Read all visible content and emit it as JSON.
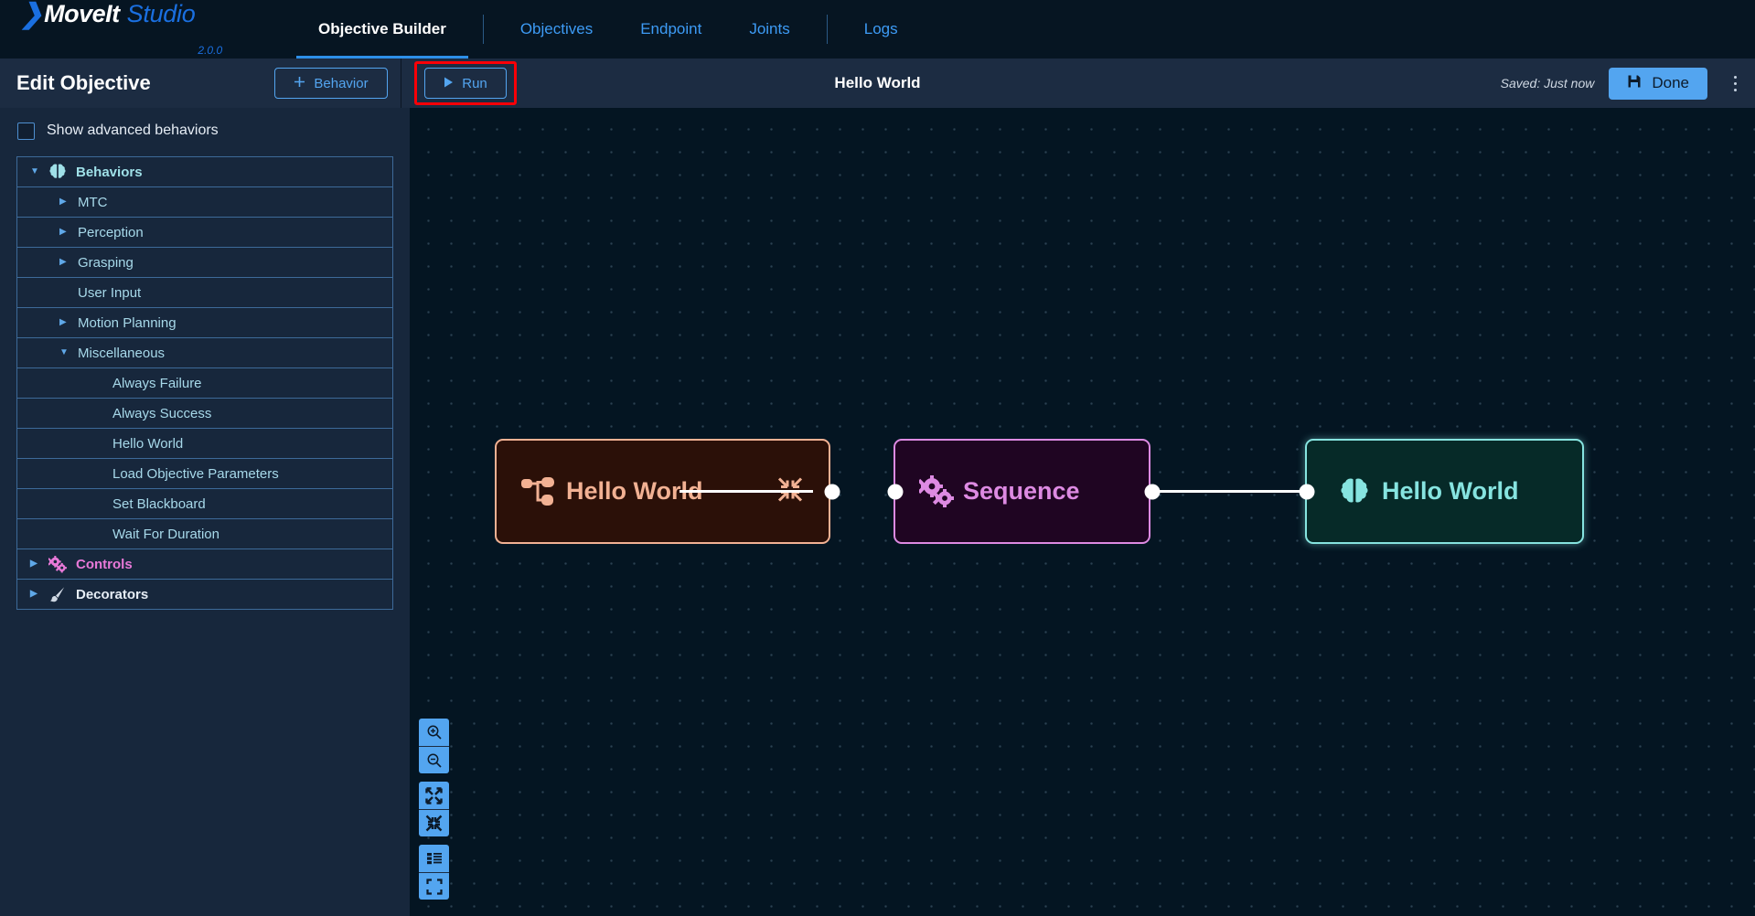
{
  "brand": {
    "chevron_icon": "chevron-right-icon",
    "name_primary": "MoveIt",
    "name_secondary": "Studio",
    "version": "2.0.0"
  },
  "nav": {
    "tabs": [
      {
        "label": "Objective Builder",
        "active": true
      },
      {
        "label": "Objectives",
        "active": false
      },
      {
        "label": "Endpoint",
        "active": false
      },
      {
        "label": "Joints",
        "active": false
      },
      {
        "label": "Logs",
        "active": false
      }
    ]
  },
  "subheader": {
    "title": "Edit Objective",
    "behavior_button": {
      "label": "Behavior",
      "icon": "plus-icon"
    },
    "run_button": {
      "label": "Run",
      "icon": "play-icon",
      "highlighted": true,
      "highlight_color": "#fb0007"
    },
    "document_title": "Hello World",
    "saved_status": "Saved: Just now",
    "done_button": {
      "label": "Done",
      "icon": "save-floppy-icon"
    },
    "overflow_menu_icon": "kebab-menu-icon"
  },
  "sidebar": {
    "advanced_toggle": {
      "label": "Show advanced behaviors",
      "checked": false
    },
    "tree": [
      {
        "label": "Behaviors",
        "depth": 0,
        "caret": "down",
        "icon": "brain-icon",
        "icon_class": "c-brain",
        "label_class": "lbl-behaviors",
        "bold": true
      },
      {
        "label": "MTC",
        "depth": 1,
        "caret": "right",
        "icon": "",
        "icon_class": "",
        "label_class": "",
        "bold": false
      },
      {
        "label": "Perception",
        "depth": 1,
        "caret": "right",
        "icon": "",
        "icon_class": "",
        "label_class": "",
        "bold": false
      },
      {
        "label": "Grasping",
        "depth": 1,
        "caret": "right",
        "icon": "",
        "icon_class": "",
        "label_class": "",
        "bold": false
      },
      {
        "label": "User Input",
        "depth": 1,
        "caret": "none",
        "icon": "",
        "icon_class": "",
        "label_class": "",
        "bold": false
      },
      {
        "label": "Motion Planning",
        "depth": 1,
        "caret": "right",
        "icon": "",
        "icon_class": "",
        "label_class": "",
        "bold": false
      },
      {
        "label": "Miscellaneous",
        "depth": 1,
        "caret": "down",
        "icon": "",
        "icon_class": "",
        "label_class": "",
        "bold": false
      },
      {
        "label": "Always Failure",
        "depth": 2,
        "caret": "none",
        "icon": "",
        "icon_class": "",
        "label_class": "",
        "bold": false
      },
      {
        "label": "Always Success",
        "depth": 2,
        "caret": "none",
        "icon": "",
        "icon_class": "",
        "label_class": "",
        "bold": false
      },
      {
        "label": "Hello World",
        "depth": 2,
        "caret": "none",
        "icon": "",
        "icon_class": "",
        "label_class": "",
        "bold": false
      },
      {
        "label": "Load Objective Parameters",
        "depth": 2,
        "caret": "none",
        "icon": "",
        "icon_class": "",
        "label_class": "",
        "bold": false
      },
      {
        "label": "Set Blackboard",
        "depth": 2,
        "caret": "none",
        "icon": "",
        "icon_class": "",
        "label_class": "",
        "bold": false
      },
      {
        "label": "Wait For Duration",
        "depth": 2,
        "caret": "none",
        "icon": "",
        "icon_class": "",
        "label_class": "",
        "bold": false
      },
      {
        "label": "Controls",
        "depth": 0,
        "caret": "right",
        "icon": "gears-icon",
        "icon_class": "c-pink",
        "label_class": "lbl-controls",
        "bold": true
      },
      {
        "label": "Decorators",
        "depth": 0,
        "caret": "right",
        "icon": "paintbrush-icon",
        "icon_class": "c-gray",
        "label_class": "lbl-decorators",
        "bold": true
      }
    ]
  },
  "canvas": {
    "nodes": [
      {
        "id": "node-hello-world-subtree",
        "label": "Hello World",
        "icon": "subtree-icon",
        "accent": "#f2b193",
        "background": "#2b1008",
        "has_collapse": true,
        "collapse_icon": "collapse-arrows-icon",
        "ports": [
          "output"
        ]
      },
      {
        "id": "node-sequence",
        "label": "Sequence",
        "icon": "gears-icon",
        "accent": "#dd8ae2",
        "background": "#1f0522",
        "has_collapse": false,
        "collapse_icon": "",
        "ports": [
          "input",
          "output"
        ]
      },
      {
        "id": "node-hello-world-leaf",
        "label": "Hello World",
        "icon": "brain-icon",
        "accent": "#86e4e0",
        "background": "#062a28",
        "has_collapse": false,
        "collapse_icon": "",
        "ports": [
          "input"
        ]
      }
    ],
    "edges": [
      {
        "from": "node-hello-world-subtree",
        "to": "node-sequence"
      },
      {
        "from": "node-sequence",
        "to": "node-hello-world-leaf"
      }
    ],
    "controls": [
      {
        "name": "zoom-in-button",
        "icon": "magnifier-plus-icon"
      },
      {
        "name": "zoom-out-button",
        "icon": "magnifier-minus-icon"
      },
      {
        "name": "expand-all-button",
        "icon": "expand-arrows-icon"
      },
      {
        "name": "collapse-all-button",
        "icon": "collapse-arrows-icon"
      },
      {
        "name": "layout-button",
        "icon": "list-layout-icon"
      },
      {
        "name": "fit-view-button",
        "icon": "fit-screen-icon"
      }
    ]
  }
}
